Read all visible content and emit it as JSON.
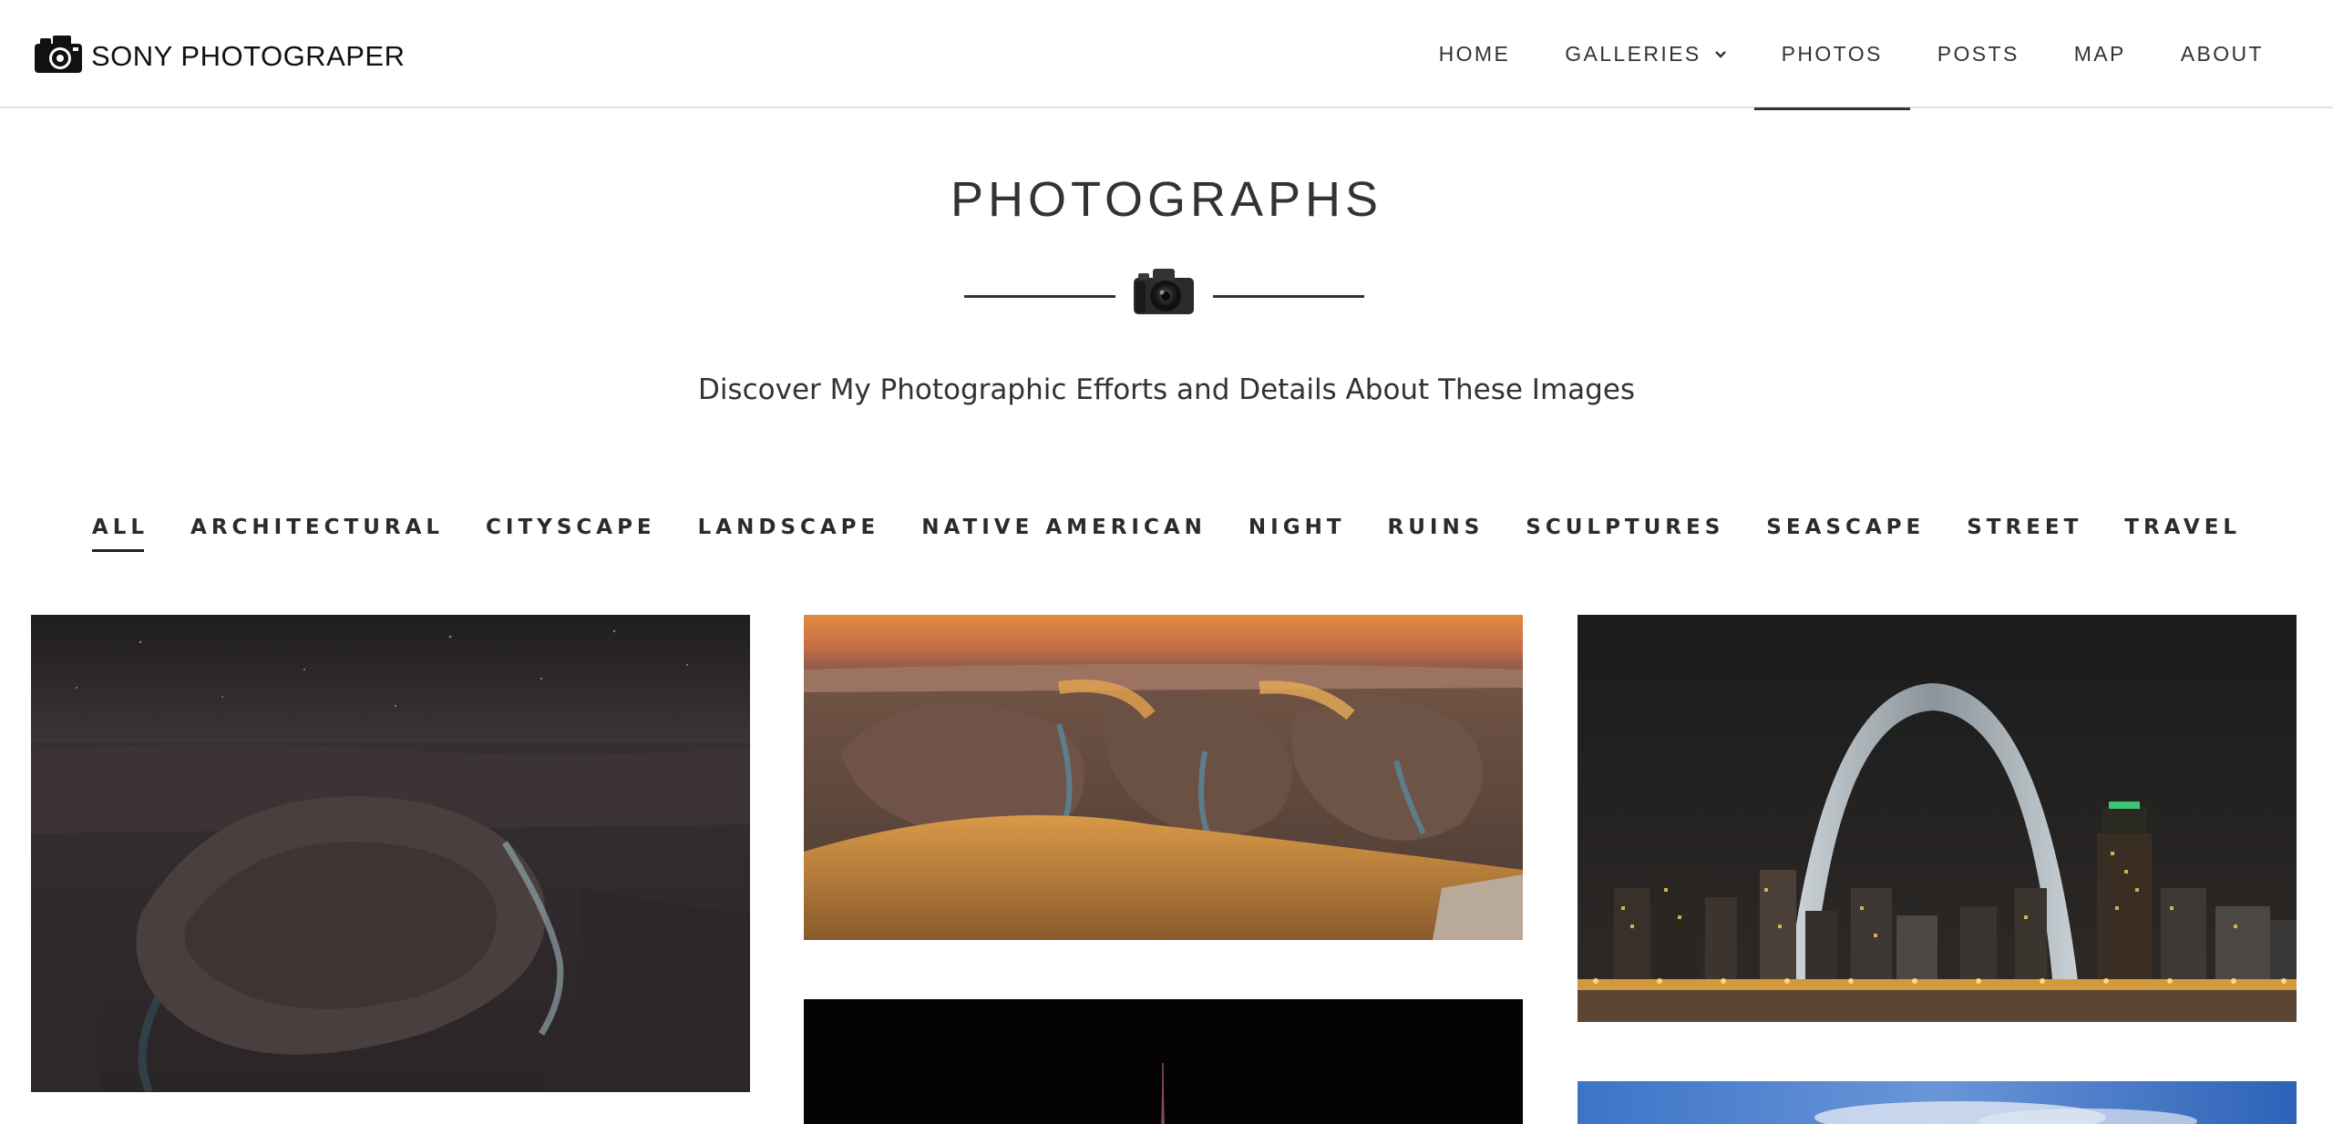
{
  "site": {
    "logo_text": "SONY PHOTOGRAPER",
    "logo_icon": "camera-icon"
  },
  "nav": {
    "items": [
      {
        "label": "HOME"
      },
      {
        "label": "GALLERIES",
        "icon": "chevron-down-icon"
      },
      {
        "label": "PHOTOS",
        "active": true
      },
      {
        "label": "POSTS"
      },
      {
        "label": "MAP"
      },
      {
        "label": "ABOUT"
      }
    ]
  },
  "page": {
    "title": "PHOTOGRAPHS",
    "divider_icon": "camera-icon",
    "subtitle": "Discover My Photographic Efforts and Details About These Images"
  },
  "filters": {
    "items": [
      {
        "label": "ALL",
        "active": true
      },
      {
        "label": "ARCHITECTURAL"
      },
      {
        "label": "CITYSCAPE"
      },
      {
        "label": "LANDSCAPE"
      },
      {
        "label": "NATIVE AMERICAN"
      },
      {
        "label": "NIGHT"
      },
      {
        "label": "RUINS"
      },
      {
        "label": "SCULPTURES"
      },
      {
        "label": "SEASCAPE"
      },
      {
        "label": "STREET"
      },
      {
        "label": "TRAVEL"
      }
    ]
  },
  "colors": {
    "text": "#2b2b2b",
    "header_border": "#e2e2e2",
    "active_underline": "#333333"
  }
}
